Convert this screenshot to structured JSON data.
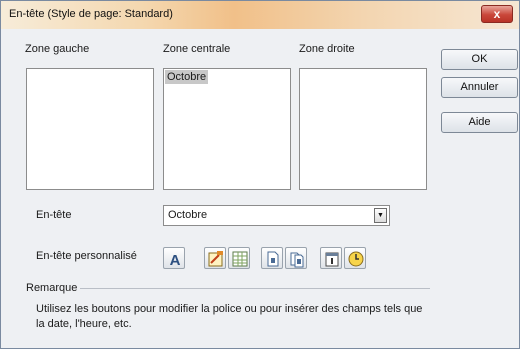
{
  "window": {
    "title": "En-tête (Style de page: Standard)",
    "close_glyph": "x"
  },
  "zones": {
    "left_label": "Zone gauche",
    "center_label": "Zone centrale",
    "center_text": "Octobre",
    "right_label": "Zone droite"
  },
  "header_row": {
    "label": "En-tête",
    "value": "Octobre"
  },
  "custom_row": {
    "label": "En-tête personnalisé",
    "buttons": [
      {
        "icon": "font-icon",
        "glyph": "A"
      },
      {
        "icon": "title-field-icon"
      },
      {
        "icon": "filename-field-icon"
      },
      {
        "icon": "page-field-icon"
      },
      {
        "icon": "page-count-field-icon"
      },
      {
        "icon": "date-field-icon"
      },
      {
        "icon": "time-field-icon"
      }
    ]
  },
  "remark": {
    "title": "Remarque",
    "text": "Utilisez les boutons pour modifier la police ou pour insérer des champs tels que la date, l'heure, etc."
  },
  "buttons": {
    "ok": "OK",
    "cancel": "Annuler",
    "help": "Aide"
  },
  "colors": {
    "titlebar_accent": "#f1c089",
    "close_button": "#c9473a",
    "selection": "#c8c8c8"
  }
}
